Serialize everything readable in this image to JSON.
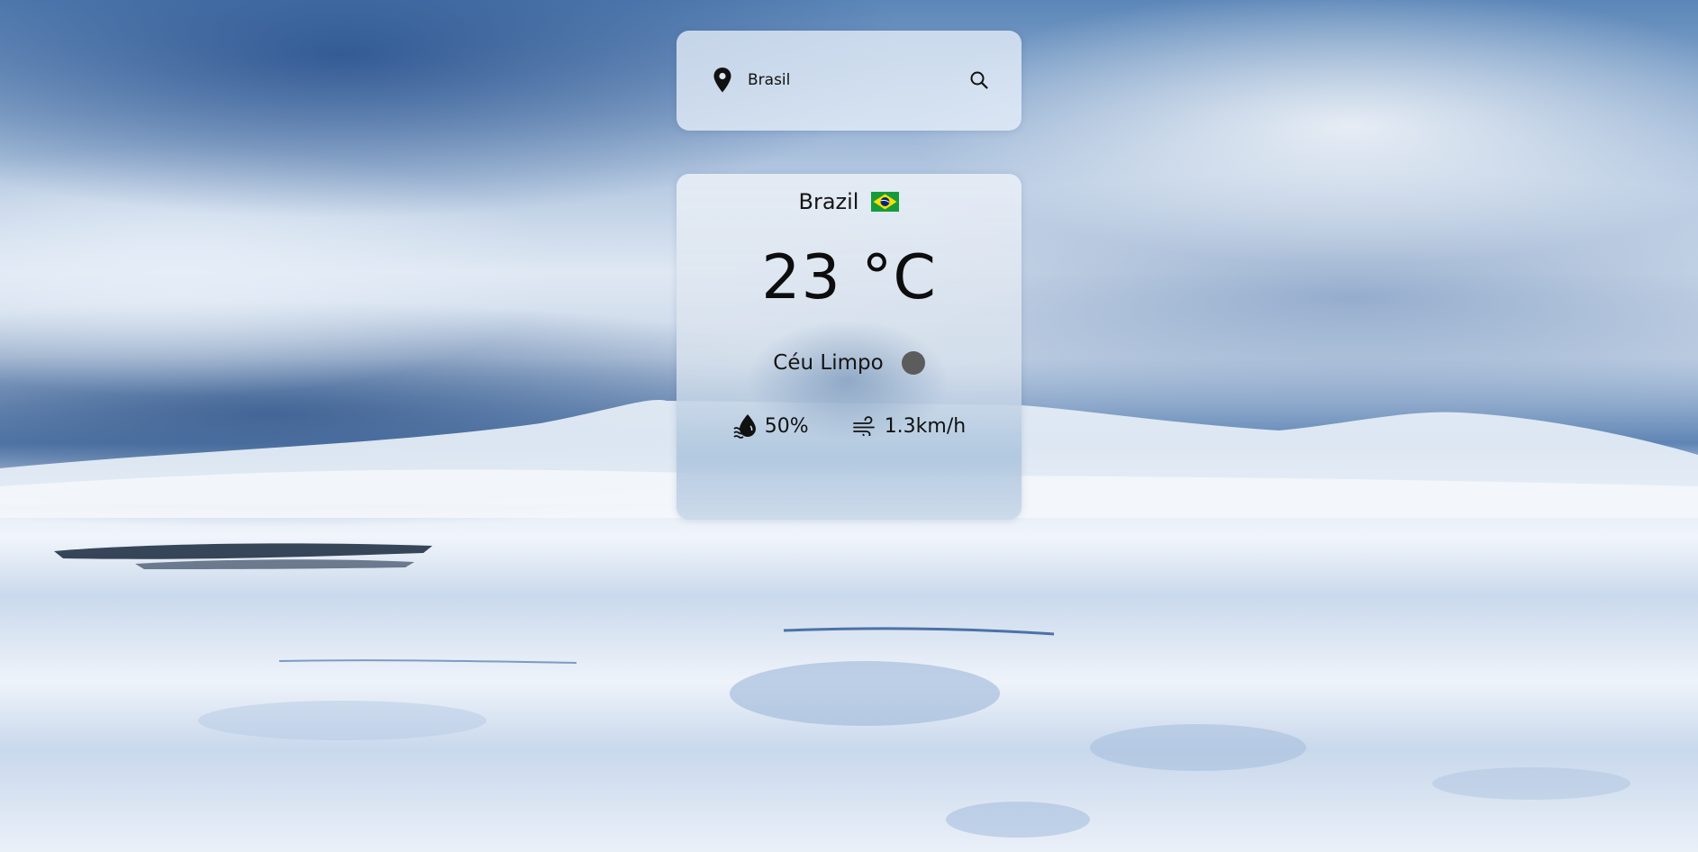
{
  "search": {
    "value": "Brasil",
    "icon_left": "map-pin-icon",
    "icon_right": "search-icon"
  },
  "weather": {
    "city": "Brazil",
    "country_flag": "brazil-flag-icon",
    "temperature": "23 °C",
    "description": "Céu Limpo",
    "condition_icon": "weather-condition-icon",
    "humidity": "50%",
    "humidity_icon": "humidity-drop-icon",
    "wind": "1.3km/h",
    "wind_icon": "wind-icon"
  },
  "colors": {
    "card_bg": "#e6eef8",
    "text": "#151515",
    "condition_icon": "#5c5c5c",
    "flag_green": "#169b3a",
    "flag_yellow": "#fedf00",
    "flag_blue": "#002776"
  }
}
